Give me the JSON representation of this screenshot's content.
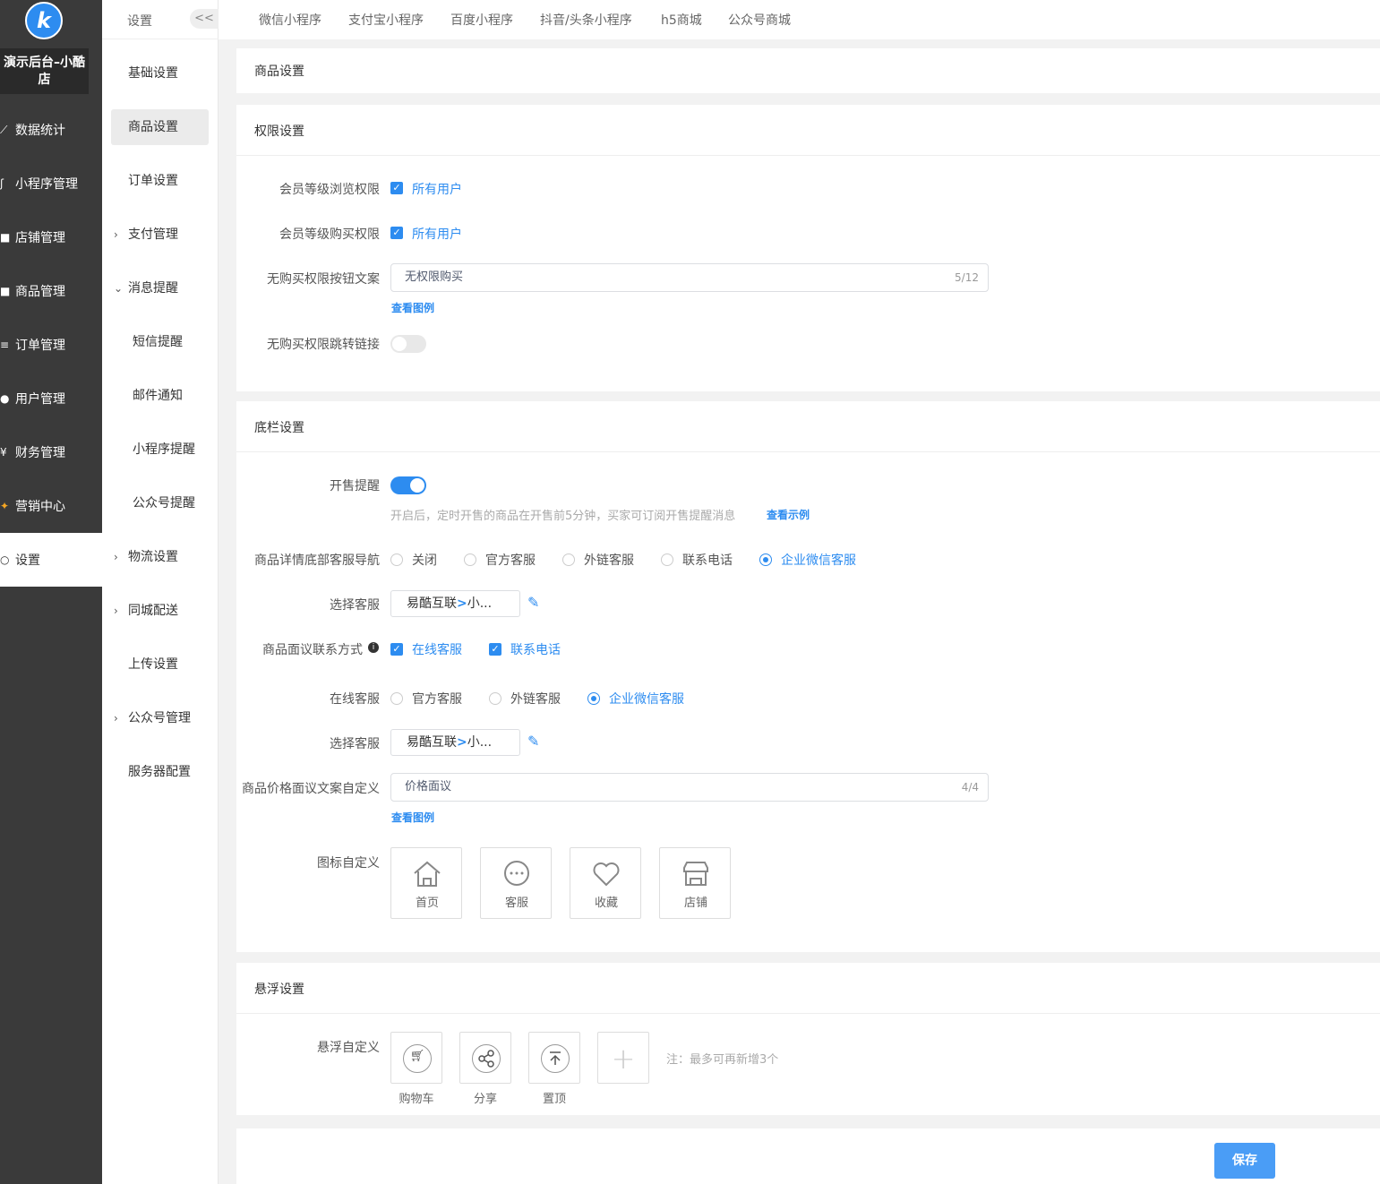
{
  "sidebar": {
    "logo": "k",
    "shop_name": "演示后台–小酷店",
    "items": [
      {
        "label": "数据统计",
        "icon": "chart-icon"
      },
      {
        "label": "小程序管理",
        "icon": "link-icon"
      },
      {
        "label": "店铺管理",
        "icon": "shop-icon"
      },
      {
        "label": "商品管理",
        "icon": "goods-icon"
      },
      {
        "label": "订单管理",
        "icon": "order-icon"
      },
      {
        "label": "用户管理",
        "icon": "user-icon"
      },
      {
        "label": "财务管理",
        "icon": "finance-icon"
      },
      {
        "label": "营销中心",
        "icon": "marketing-icon"
      },
      {
        "label": "设置",
        "icon": "settings-icon"
      }
    ]
  },
  "subsidebar": {
    "title": "设置",
    "collapse": "<<",
    "items": [
      {
        "label": "基础设置"
      },
      {
        "label": "商品设置"
      },
      {
        "label": "订单设置"
      },
      {
        "label": "支付管理"
      },
      {
        "label": "消息提醒"
      },
      {
        "label": "短信提醒"
      },
      {
        "label": "邮件通知"
      },
      {
        "label": "小程序提醒"
      },
      {
        "label": "公众号提醒"
      },
      {
        "label": "物流设置"
      },
      {
        "label": "同城配送"
      },
      {
        "label": "上传设置"
      },
      {
        "label": "公众号管理"
      },
      {
        "label": "服务器配置"
      }
    ]
  },
  "tabs": [
    "微信小程序",
    "支付宝小程序",
    "百度小程序",
    "抖音/头条小程序",
    "h5商城",
    "公众号商城"
  ],
  "goods_settings": {
    "title": "商品设置"
  },
  "permission": {
    "title": "权限设置",
    "browse_label": "会员等级浏览权限",
    "browse_value": "所有用户",
    "buy_label": "会员等级购买权限",
    "buy_value": "所有用户",
    "button_text_label": "无购买权限按钮文案",
    "button_text_value": "无权限购买",
    "button_text_count": "5/12",
    "view_example": "查看图例",
    "jump_label": "无购买权限跳转链接"
  },
  "bottom_bar": {
    "title": "底栏设置",
    "presale_label": "开售提醒",
    "presale_hint": "开启后，定时开售的商品在开售前5分钟，买家可订阅开售提醒消息",
    "presale_link": "查看示例",
    "nav_label": "商品详情底部客服导航",
    "nav_options": [
      "关闭",
      "官方客服",
      "外链客服",
      "联系电话",
      "企业微信客服"
    ],
    "select_service_label": "选择客服",
    "select_service_value_a": "易酷互联",
    "select_service_value_gt": ">",
    "select_service_value_b": "小...",
    "negotiate_label": "商品面议联系方式",
    "negotiate_info": "i",
    "negotiate_opts": [
      "在线客服",
      "联系电话"
    ],
    "online_label": "在线客服",
    "online_options": [
      "官方客服",
      "外链客服",
      "企业微信客服"
    ],
    "select_service_label2": "选择客服",
    "price_text_label": "商品价格面议文案自定义",
    "price_text_value": "价格面议",
    "price_text_count": "4/4",
    "view_example": "查看图例",
    "icon_label": "图标自定义",
    "icons": [
      "首页",
      "客服",
      "收藏",
      "店铺"
    ]
  },
  "float": {
    "title": "悬浮设置",
    "label": "悬浮自定义",
    "items": [
      "购物车",
      "分享",
      "置顶"
    ],
    "note": "注：最多可再新增3个"
  },
  "save": "保存",
  "colors": {
    "accent": "#2d8cf0",
    "sidebar": "#3a3a3a",
    "save": "#4a9df6"
  }
}
